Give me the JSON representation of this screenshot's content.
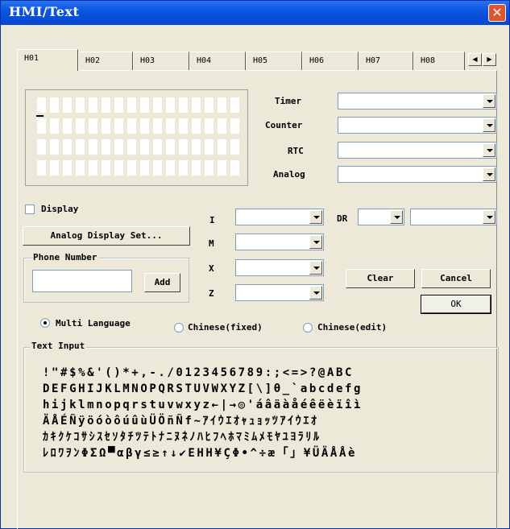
{
  "window": {
    "title": "HMI/Text"
  },
  "tabs": [
    "H01",
    "H02",
    "H03",
    "H04",
    "H05",
    "H06",
    "H07",
    "H08"
  ],
  "tab_arrows": {
    "left": "◀",
    "right": "▶"
  },
  "fields": {
    "timer_label": "Timer",
    "counter_label": "Counter",
    "rtc_label": "RTC",
    "analog_label": "Analog",
    "i_label": "I",
    "m_label": "M",
    "x_label": "X",
    "z_label": "Z",
    "dr_label": "DR"
  },
  "display_checkbox": {
    "label": "Display",
    "checked": false
  },
  "buttons": {
    "analog_display_set": "Analog Display Set...",
    "add": "Add",
    "clear": "Clear",
    "cancel": "Cancel",
    "ok": "OK"
  },
  "phone_number": {
    "legend": "Phone Number",
    "value": ""
  },
  "language": {
    "multi": "Multi Language",
    "chinese_fixed": "Chinese(fixed)",
    "chinese_edit": "Chinese(edit)",
    "selected": "multi"
  },
  "text_input": {
    "legend": "Text Input",
    "rows": [
      " !\"#$%&'()*+,-./0123456789:;<=>?@ABC",
      "DEFGHIJKLMNOPQRSTUVWXYZ[\\]θ_`abcdefg",
      "hijklmnopqrstuvwxyz←|→◎'áâäàåéêëèïîì",
      "ÄÅÉÑÿöóòôúûùÜÖñÑf~ｱｲｳｴｵｬｭｮｯﾂｱｲｳｴｵ",
      "ｶｷｸｹｺｻｼｽｾｿﾀﾁﾂﾃﾄﾅﾆﾇﾈﾉﾊﾋﾌﾍﾎﾏﾐﾑﾒﾓﾔﾕﾖﾗﾘﾙ",
      "ﾚﾛﾜｦﾝΦΣΩ▀αβγ≤≥↑↓✔EHH¥ÇΦ•^÷æ「」¥ÜÄÅÅè"
    ]
  },
  "colors": {
    "titlebar": "#0a55e0",
    "dialog_bg": "#ece9d8",
    "close_button": "#e0552e"
  }
}
